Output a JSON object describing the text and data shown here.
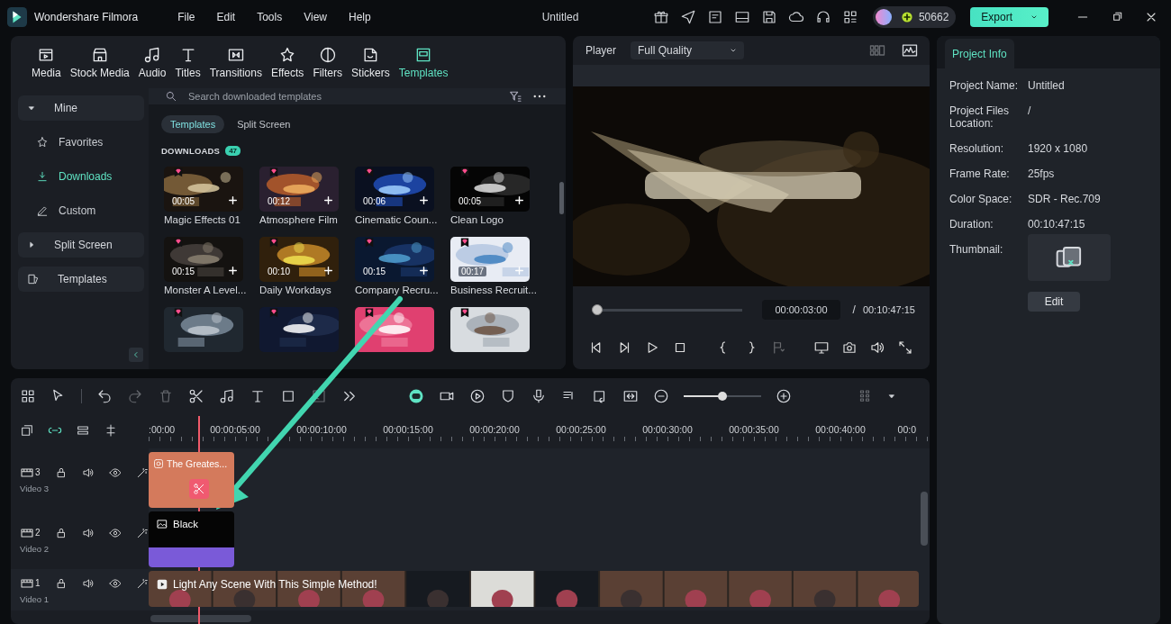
{
  "app": {
    "name": "Wondershare Filmora",
    "menu": [
      "File",
      "Edit",
      "Tools",
      "View",
      "Help"
    ],
    "title": "Untitled",
    "credits": "50662",
    "export": "Export"
  },
  "media_tabs": [
    {
      "label": "Media",
      "selected": false
    },
    {
      "label": "Stock Media",
      "selected": false
    },
    {
      "label": "Audio",
      "selected": false
    },
    {
      "label": "Titles",
      "selected": false
    },
    {
      "label": "Transitions",
      "selected": false
    },
    {
      "label": "Effects",
      "selected": false
    },
    {
      "label": "Filters",
      "selected": false
    },
    {
      "label": "Stickers",
      "selected": false
    },
    {
      "label": "Templates",
      "selected": true
    }
  ],
  "sidebar": {
    "items": [
      {
        "label": "Mine",
        "kind": "group",
        "expanded": true,
        "selected": false
      },
      {
        "label": "Favorites",
        "kind": "sub",
        "selected": false
      },
      {
        "label": "Downloads",
        "kind": "sub",
        "selected": true
      },
      {
        "label": "Custom",
        "kind": "sub",
        "selected": false
      },
      {
        "label": "Split Screen",
        "kind": "group",
        "expanded": false,
        "selected": false
      },
      {
        "label": "Templates",
        "kind": "link",
        "selected": false
      }
    ]
  },
  "search": {
    "placeholder": "Search downloaded templates"
  },
  "filter_tabs": [
    {
      "label": "Templates",
      "selected": true
    },
    {
      "label": "Split Screen",
      "selected": false
    }
  ],
  "section": {
    "title": "DOWNLOADS",
    "count": "47"
  },
  "templates": [
    {
      "kind": "template",
      "name": "Magic Effects 01",
      "duration": "00:05"
    },
    {
      "kind": "template",
      "name": "Atmosphere Film",
      "duration": "00:12"
    },
    {
      "kind": "template",
      "name": "Cinematic Coun...",
      "duration": "00:06"
    },
    {
      "kind": "template",
      "name": "Clean Logo",
      "duration": "00:05"
    },
    {
      "kind": "template",
      "name": "Monster A Level...",
      "duration": "00:15"
    },
    {
      "kind": "template",
      "name": "Daily Workdays",
      "duration": "00:10"
    },
    {
      "kind": "template",
      "name": "Company Recru...",
      "duration": "00:15"
    },
    {
      "kind": "template",
      "name": "Business Recruit...",
      "duration": "00:17"
    },
    {
      "kind": "picture"
    },
    {
      "kind": "picture"
    },
    {
      "kind": "picture"
    },
    {
      "kind": "picture"
    }
  ],
  "player": {
    "label": "Player",
    "quality": "Full Quality",
    "level": 0.03,
    "current": "00:00:03:00",
    "separator": "/",
    "total": "00:10:47:15"
  },
  "project_info": {
    "tab": "Project Info",
    "fields": [
      {
        "label": "Project Name:",
        "value": "Untitled"
      },
      {
        "label": "Project Files Location:",
        "value": "/"
      },
      {
        "label": "Resolution:",
        "value": "1920 x 1080"
      },
      {
        "label": "Frame Rate:",
        "value": "25fps"
      },
      {
        "label": "Color Space:",
        "value": "SDR - Rec.709"
      },
      {
        "label": "Duration:",
        "value": "00:10:47:15"
      }
    ],
    "thumbnail_label": "Thumbnail:",
    "edit": "Edit"
  },
  "timeline": {
    "zoom": {
      "level": 0.5
    },
    "ruler": [
      ":00:00",
      "00:00:05:00",
      "00:00:10:00",
      "00:00:15:00",
      "00:00:20:00",
      "00:00:25:00",
      "00:00:30:00",
      "00:00:35:00",
      "00:00:40:00",
      "00:0"
    ],
    "tracks": [
      {
        "number": "3",
        "name": "Video 3",
        "clip": {
          "kind": "title",
          "title": "The Greates..."
        }
      },
      {
        "number": "2",
        "name": "Video 2",
        "clip": {
          "kind": "color",
          "title": "Black"
        }
      },
      {
        "number": "1",
        "name": "Video 1",
        "clip": {
          "kind": "video",
          "title": "Light Any Scene With This Simple Method!"
        }
      }
    ]
  }
}
